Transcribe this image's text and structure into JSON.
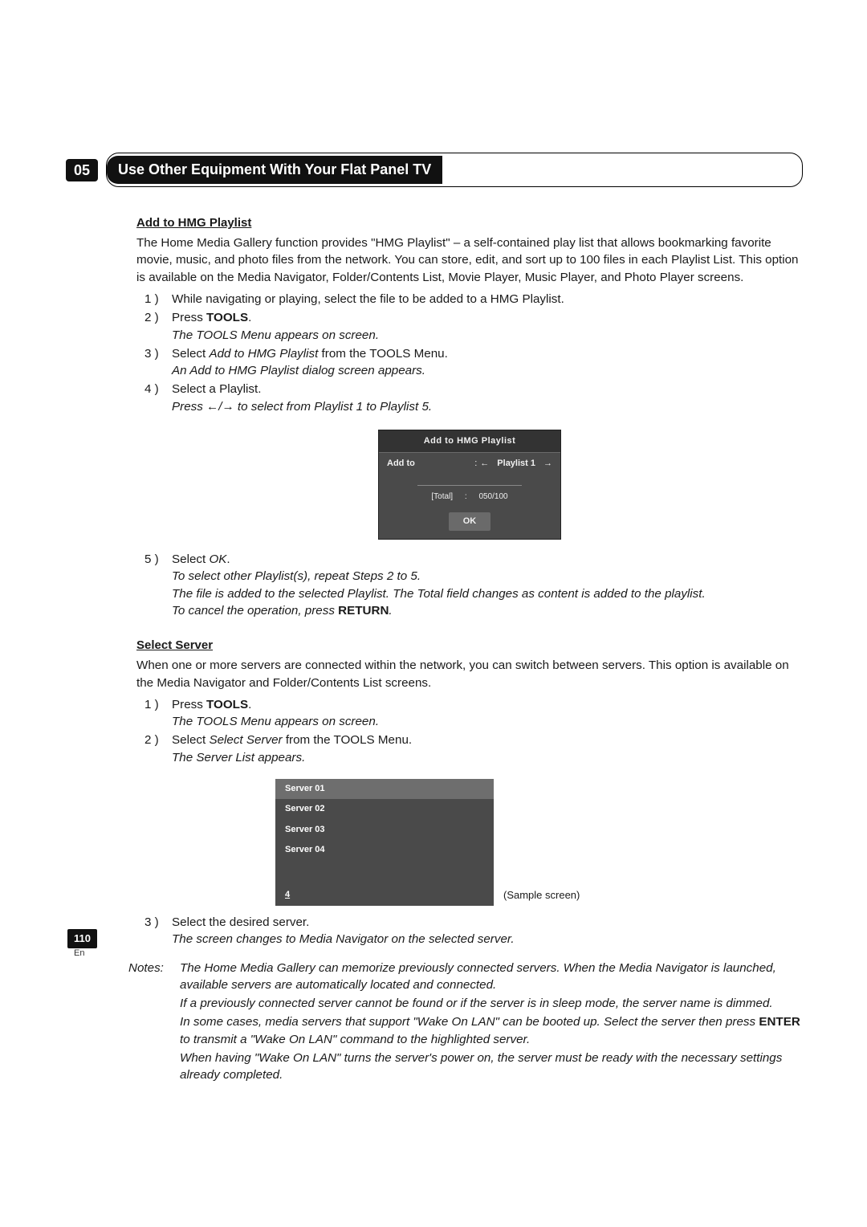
{
  "chapter": {
    "number": "05",
    "title": "Use Other Equipment With Your Flat Panel TV"
  },
  "section1": {
    "heading": "Add to HMG Playlist",
    "intro": "The Home Media Gallery function provides \"HMG Playlist\" – a self-contained play list that allows bookmarking favorite movie, music, and photo files from the network. You can store, edit, and sort up to 100 files in each Playlist List. This option is available on the Media Navigator, Folder/Contents List, Movie Player, Music Player, and Photo Player screens.",
    "steps": [
      {
        "n": "1 )",
        "text": "While navigating or playing, select the file to be added to a HMG Playlist."
      },
      {
        "n": "2 )",
        "text_pre": "Press ",
        "bold": "TOOLS",
        "text_post": ".",
        "note": "The TOOLS Menu appears on screen."
      },
      {
        "n": "3 )",
        "text_pre": "Select ",
        "ital": "Add to HMG Playlist",
        "text_post": " from the TOOLS Menu.",
        "note": "An Add to HMG Playlist dialog screen appears."
      },
      {
        "n": "4 )",
        "text": "Select a Playlist.",
        "note_pre": "Press ",
        "note_mid": "/",
        "note_post": " to select from Playlist 1 to Playlist 5.",
        "arrows": {
          "l": "←",
          "r": "→"
        }
      }
    ],
    "dialog": {
      "title": "Add to HMG Playlist",
      "addto_label": "Add to",
      "colon": ":",
      "arrow_l": "←",
      "value": "Playlist 1",
      "arrow_r": "→",
      "total_label": "[Total]",
      "total_value": "050/100",
      "ok": "OK"
    },
    "steps_after": [
      {
        "n": "5 )",
        "text_pre": "Select ",
        "ital": "OK",
        "text_post": ".",
        "notes": [
          "To select other Playlist(s), repeat Steps 2 to 5.",
          "The file is added to the selected Playlist. The Total field changes as content is added to the playlist."
        ],
        "cancel_pre": "To cancel the operation, press ",
        "cancel_bold": "RETURN",
        "cancel_post": "."
      }
    ]
  },
  "section2": {
    "heading": "Select Server",
    "intro": "When one or more servers are connected within the network, you can switch between servers. This option is available on the Media Navigator and Folder/Contents List screens.",
    "steps": [
      {
        "n": "1 )",
        "text_pre": "Press ",
        "bold": "TOOLS",
        "text_post": ".",
        "note": "The TOOLS Menu appears on screen."
      },
      {
        "n": "2 )",
        "text_pre": "Select ",
        "ital": "Select Server",
        "text_post": " from the TOOLS Menu.",
        "note": "The Server List appears."
      }
    ],
    "server_box": {
      "items": [
        "Server 01",
        "Server 02",
        "Server 03",
        "Server 04"
      ],
      "footer": "4",
      "caption": "(Sample screen)"
    },
    "steps_after": [
      {
        "n": "3 )",
        "text": "Select the desired server.",
        "note": "The screen changes to Media Navigator on the selected server."
      }
    ]
  },
  "notes": {
    "label": "Notes:",
    "lines": [
      {
        "t": "The Home Media Gallery can memorize previously connected servers. When the Media Navigator is launched, available servers are automatically located and connected."
      },
      {
        "t": "If a previously connected server cannot be found or if the server is in sleep mode, the server name is dimmed."
      },
      {
        "t_pre": "In some cases, media servers that support \"Wake On LAN\" can be booted up. Select the server then press ",
        "bold": "ENTER",
        "t_post": " to transmit a \"Wake On LAN\" command to the highlighted server."
      },
      {
        "t": "When having \"Wake On LAN\" turns the server's power on, the server must be ready with the necessary settings already completed."
      }
    ]
  },
  "page": {
    "number": "110",
    "lang": "En"
  }
}
